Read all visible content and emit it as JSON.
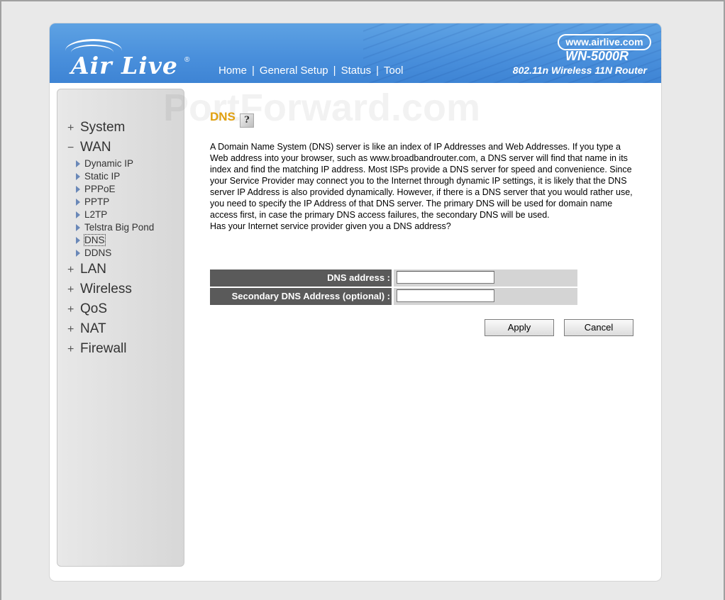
{
  "header": {
    "logo_text": "Air Live",
    "logo_reg": "®",
    "url": "www.airlive.com",
    "model": "WN-5000R",
    "model_desc": "802.11n Wireless 11N Router",
    "nav": [
      {
        "label": "Home"
      },
      {
        "label": "General Setup"
      },
      {
        "label": "Status"
      },
      {
        "label": "Tool"
      }
    ],
    "nav_separator": "|"
  },
  "sidebar": {
    "collapsed_sign": "+",
    "expanded_sign": "−",
    "items": [
      {
        "label": "System"
      },
      {
        "label": "WAN"
      },
      {
        "label": "LAN"
      },
      {
        "label": "Wireless"
      },
      {
        "label": "QoS"
      },
      {
        "label": "NAT"
      },
      {
        "label": "Firewall"
      }
    ],
    "wan_sub": [
      {
        "label": "Dynamic IP"
      },
      {
        "label": "Static IP"
      },
      {
        "label": "PPPoE"
      },
      {
        "label": "PPTP"
      },
      {
        "label": "L2TP"
      },
      {
        "label": "Telstra Big Pond"
      },
      {
        "label": "DNS"
      },
      {
        "label": "DDNS"
      }
    ],
    "active_sub": "DNS"
  },
  "content": {
    "title": "DNS",
    "help_glyph": "?",
    "description": "A Domain Name System (DNS) server is like an index of IP Addresses and Web Addresses. If you type a Web address into your browser, such as www.broadbandrouter.com, a DNS server will find that name in its index and find the matching IP address. Most ISPs provide a DNS server for speed and convenience. Since your Service Provider may connect you to the Internet through dynamic IP settings, it is likely that the DNS server IP Address is also provided dynamically. However, if there is a DNS server that you would rather use, you need to specify the IP Address of that DNS server. The primary DNS will be used for domain name access first, in case the primary DNS access failures, the secondary DNS will be used.",
    "question": "Has your Internet service provider given you a DNS address?",
    "watermark": "PortForward.com"
  },
  "form": {
    "dns_label": "DNS address :",
    "dns_value": "",
    "secondary_label": "Secondary DNS Address (optional) :",
    "secondary_value": ""
  },
  "buttons": {
    "apply": "Apply",
    "cancel": "Cancel"
  },
  "colors": {
    "header_blue": "#4a90dc",
    "title_orange": "#e0a010",
    "label_gray": "#5a5a5a"
  }
}
